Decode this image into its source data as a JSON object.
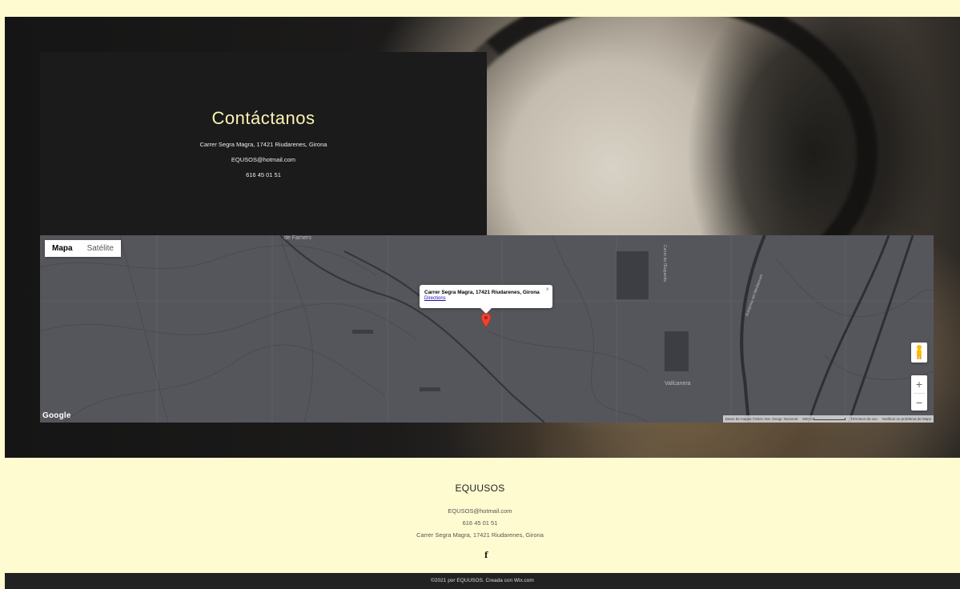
{
  "contact": {
    "title": "Contáctanos",
    "address": "Carrer Segra Magra, 17421 Riudarenes, Girona",
    "email": "EQUSOS@hotmail.com",
    "phone": "616 45 01 51"
  },
  "map": {
    "type_buttons": [
      "Mapa",
      "Satélite"
    ],
    "selected_type": "Mapa",
    "info_window": {
      "title": "Carrer Segra Magra, 17421 Riudarenes, Girona",
      "link": "Directions",
      "close": "×"
    },
    "labels": [
      "de Farners",
      "Carrer de l'Esquerda",
      "Autopista del Mediterrani",
      "Vallcanera"
    ],
    "logo": "Google",
    "zoom_in": "+",
    "zoom_out": "−",
    "footer": {
      "data": "Datos de mapas ©2021 Inst. Geogr. Nacional",
      "scale": "500 m",
      "terms": "Términos de uso",
      "report": "Notificar un problema de Maps"
    },
    "icons": {
      "marker": "map-marker-icon",
      "pegman": "pegman-icon"
    },
    "colors": {
      "marker": "#ea4335",
      "map_bg": "#55565c"
    }
  },
  "footer": {
    "brand": "EQUUSOS",
    "email": "EQUSOS@hotmail.com",
    "phone": "616 45 01 51",
    "address": "Carrer Segra Magra, 17421 Riudarenes, Girona",
    "social_icon": "f",
    "copyright": "©2021 por EQUUSOS. Creada con Wix.com"
  },
  "colors": {
    "page_bg": "#fefbd0",
    "panel_bg": "#1b1b1b",
    "title_color": "#fbf4b4",
    "copyright_bg": "#222222"
  }
}
